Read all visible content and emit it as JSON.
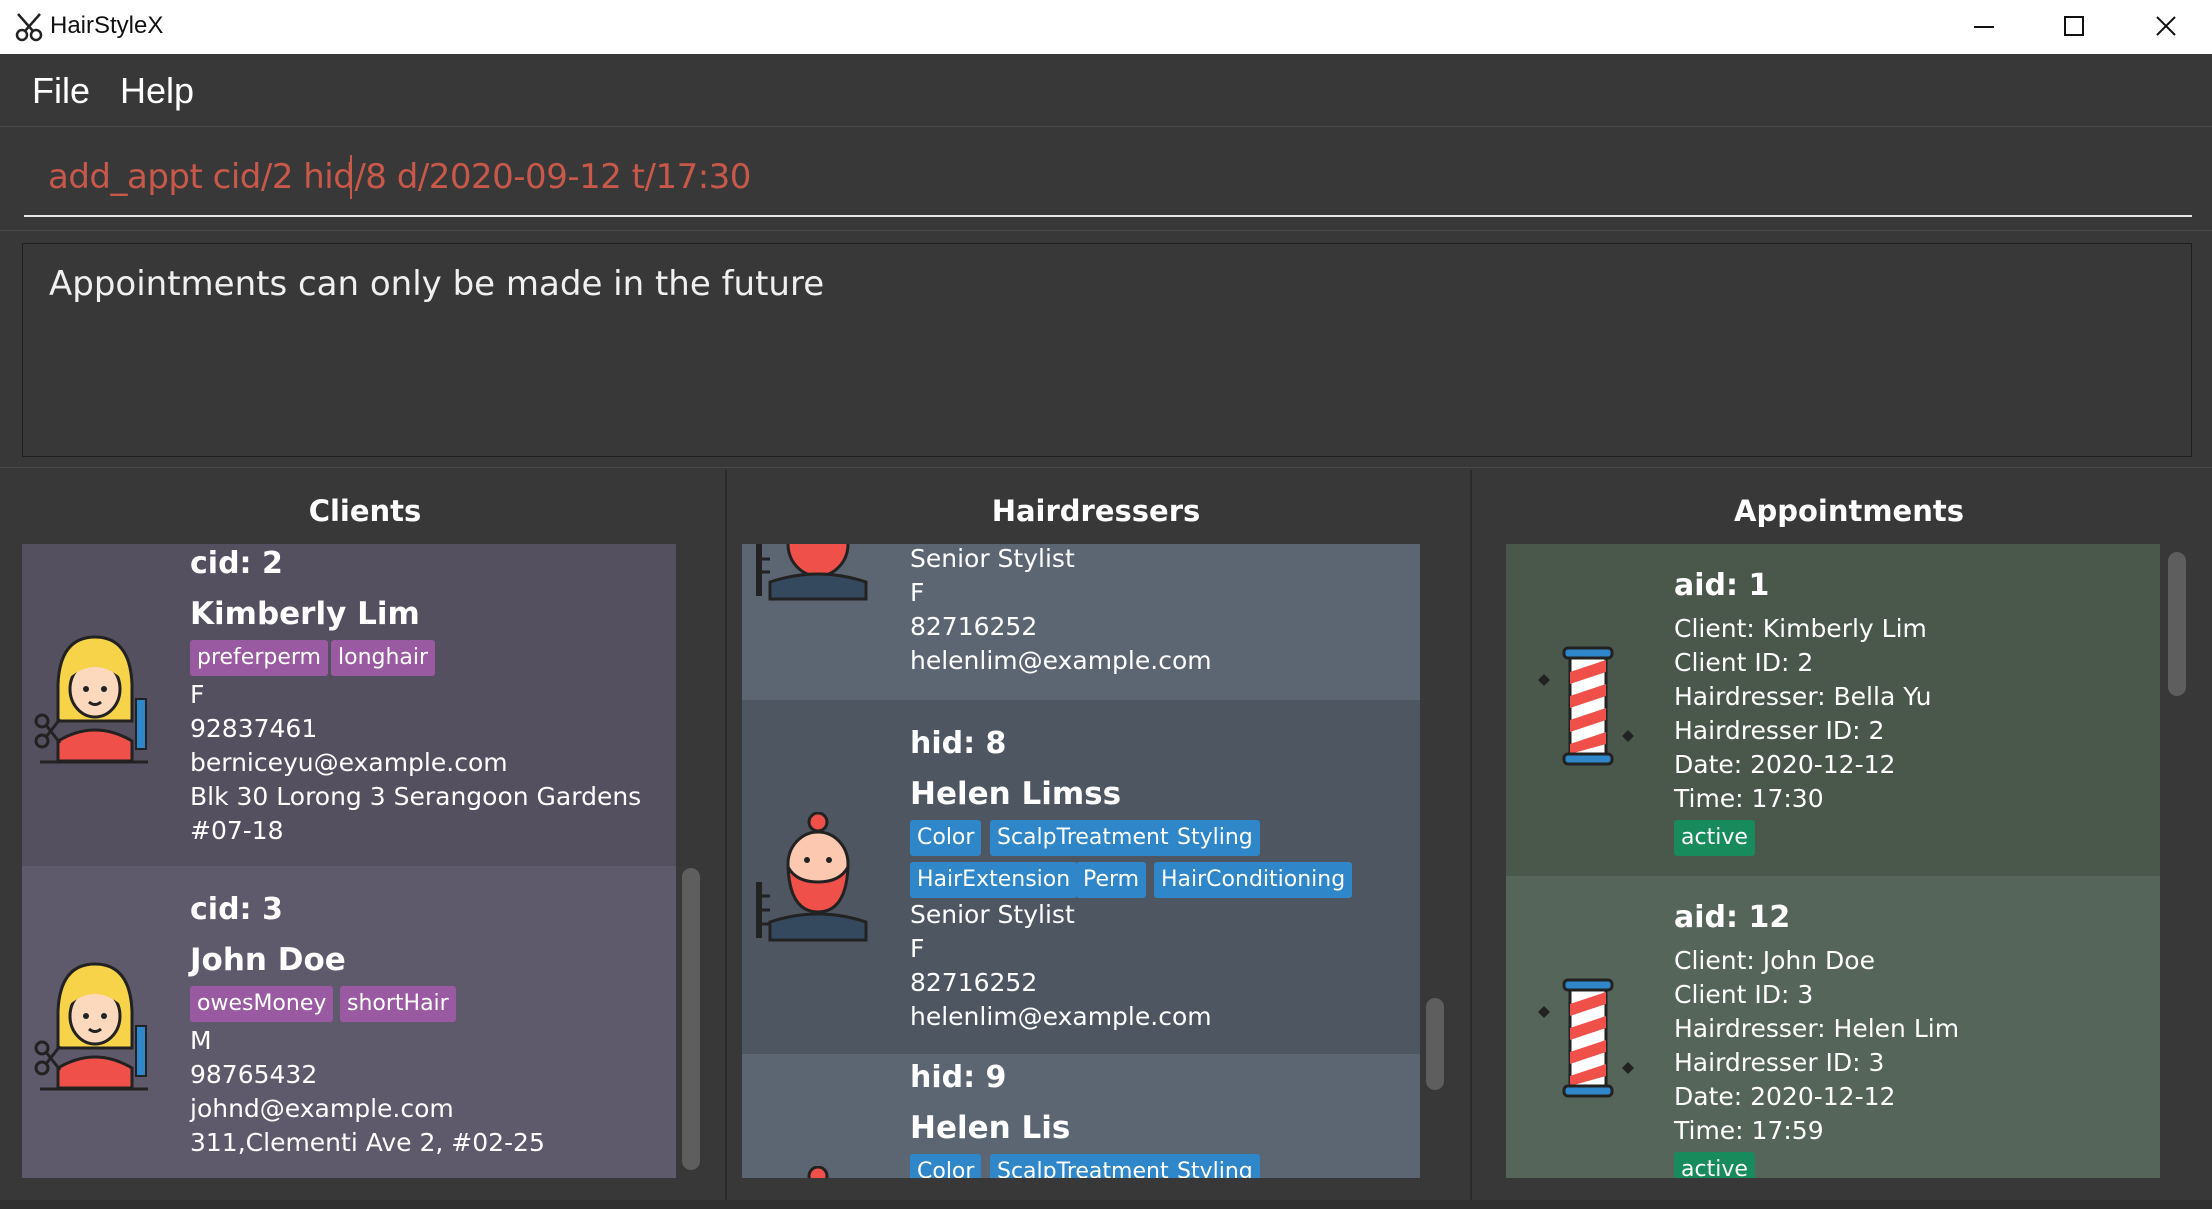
{
  "window": {
    "title": "HairStyleX",
    "controls": {
      "minimize": "minimize-icon",
      "maximize": "maximize-icon",
      "close": "close-icon"
    }
  },
  "menu": {
    "items": [
      "File",
      "Help"
    ]
  },
  "command": {
    "value": "add_appt cid/2 hid/8 d/2020-09-12 t/17:30",
    "color": "#c8584a"
  },
  "result": {
    "message": "Appointments can only be made in the future"
  },
  "panels": {
    "clients_title": "Clients",
    "hairdressers_title": "Hairdressers",
    "appointments_title": "Appointments"
  },
  "clients": [
    {
      "id_label": "cid: 2",
      "name": "Kimberly Lim",
      "tags": [
        "preferperm",
        "longhair"
      ],
      "gender": "F",
      "phone": "92837461",
      "email": "berniceyu@example.com",
      "address_line1": "Blk 30 Lorong 3 Serangoon Gardens",
      "address_line2": "#07-18"
    },
    {
      "id_label": "cid: 3",
      "name": "John Doe",
      "tags": [
        "owesMoney",
        "shortHair"
      ],
      "gender": "M",
      "phone": "98765432",
      "email": "johnd@example.com",
      "address_line1": "311,Clementi Ave 2, #02-25"
    }
  ],
  "hairdressers": [
    {
      "title": "Senior Stylist",
      "gender": "F",
      "phone": "82716252",
      "email": "helenlim@example.com"
    },
    {
      "id_label": "hid: 8",
      "name": "Helen Limss",
      "tags": [
        "Color",
        "ScalpTreatment",
        "Styling",
        "HairExtension",
        "Perm",
        "HairConditioning"
      ],
      "title": "Senior Stylist",
      "gender": "F",
      "phone": "82716252",
      "email": "helenlim@example.com"
    },
    {
      "id_label": "hid: 9",
      "name": "Helen Lis",
      "tags": [
        "Color",
        "ScalpTreatment",
        "Styling"
      ]
    }
  ],
  "appointments": [
    {
      "id_label": "aid: 1",
      "client": "Client:  Kimberly Lim",
      "client_id": "Client ID: 2",
      "hairdresser": "Hairdresser:  Bella Yu",
      "hairdresser_id": "Hairdresser ID: 2",
      "date": "Date: 2020-12-12",
      "time": "Time: 17:30",
      "status": "active"
    },
    {
      "id_label": "aid: 12",
      "client": "Client:  John Doe",
      "client_id": "Client ID: 3",
      "hairdresser": "Hairdresser:  Helen Lim",
      "hairdresser_id": "Hairdresser ID: 3",
      "date": "Date: 2020-12-12",
      "time": "Time: 17:59",
      "status": "active"
    }
  ],
  "colors": {
    "client_card_1": "#555060",
    "client_card_2": "#5f5a6b",
    "hairdresser_card_a": "#5c6672",
    "hairdresser_card_b": "#4d5661",
    "appointment_card_1": "#4a584c",
    "appointment_card_2": "#56655a",
    "tag_client": "#9a5aa2",
    "tag_hairdresser": "#2f86c8",
    "tag_status": "#178b5c"
  }
}
